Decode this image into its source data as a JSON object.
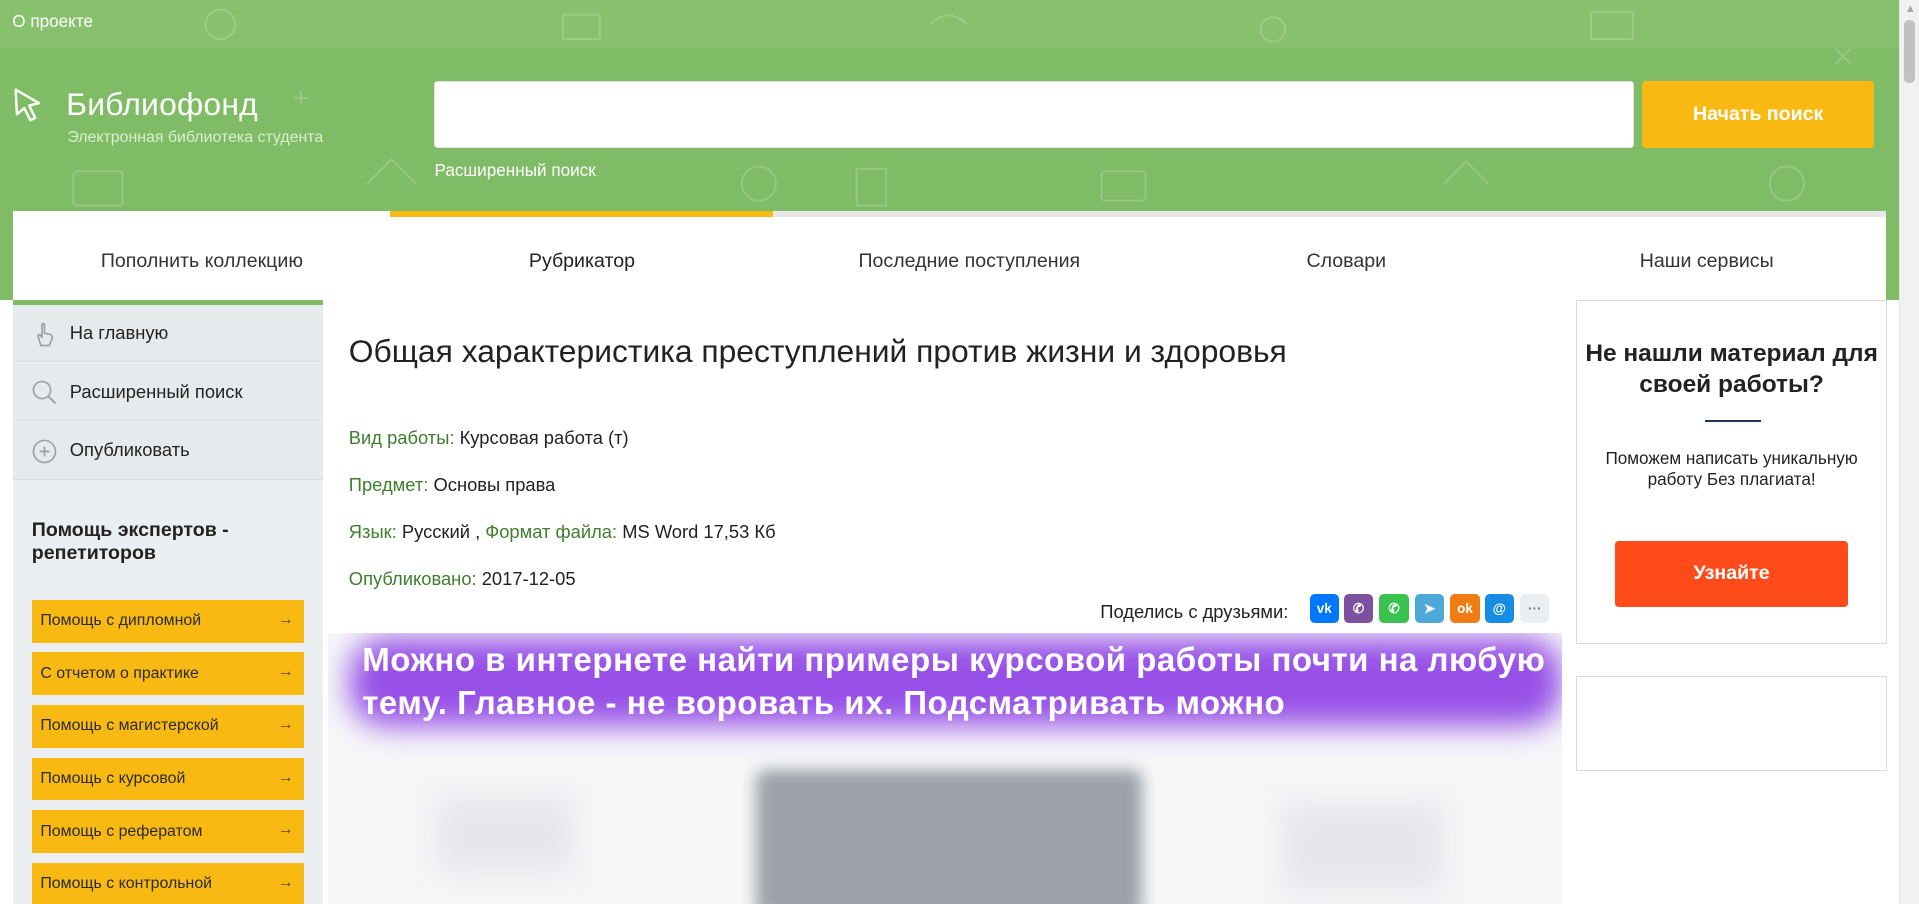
{
  "top": {
    "about_link": "О проекте"
  },
  "logo": {
    "title": "Библиофонд",
    "subtitle": "Электронная библиотека студента"
  },
  "search": {
    "value": "",
    "placeholder": "",
    "button": "Начать поиск",
    "advanced_link": "Расширенный поиск"
  },
  "nav": {
    "items": [
      {
        "label": "Пополнить коллекцию"
      },
      {
        "label": "Рубрикатор",
        "active": true
      },
      {
        "label": "Последние поступления"
      },
      {
        "label": "Словари"
      },
      {
        "label": "Наши сервисы"
      }
    ]
  },
  "sidebar": {
    "items": [
      {
        "label": "На главную",
        "icon": "hand-pointer-icon"
      },
      {
        "label": "Расширенный поиск",
        "icon": "magnifier-icon"
      },
      {
        "label": "Опубликовать",
        "icon": "plus-circle-icon"
      }
    ],
    "help_heading": "Помощь экспертов - репетиторов",
    "help_buttons": [
      "Помощь с дипломной",
      "С отчетом о практике",
      "Помощь с магистерской",
      "Помощь с курсовой",
      "Помощь с рефератом",
      "Помощь с контрольной"
    ],
    "arrow": "→"
  },
  "article": {
    "title": "Общая характеристика преступлений против жизни и здоровья",
    "work_type_label": "Вид работы:",
    "work_type": "Курсовая работа (т)",
    "subject_label": "Предмет:",
    "subject": "Основы права",
    "language_label": "Язык:",
    "language": "Русский",
    "comma": ",",
    "format_label": "Формат файла:",
    "format": "MS Word 17,53 Кб",
    "published_label": "Опубликовано:",
    "published": "2017-12-05"
  },
  "share": {
    "label": "Поделись с друзьями:",
    "icons": [
      {
        "name": "vk-icon",
        "glyph": "vk",
        "color": "#0077ff"
      },
      {
        "name": "viber-icon",
        "glyph": "✆",
        "color": "#7d51a0"
      },
      {
        "name": "whatsapp-icon",
        "glyph": "✆",
        "color": "#3ac24f"
      },
      {
        "name": "telegram-icon",
        "glyph": "➤",
        "color": "#4ea9d9"
      },
      {
        "name": "odnoklassniki-icon",
        "glyph": "ok",
        "color": "#ef7d14"
      },
      {
        "name": "moimir-icon",
        "glyph": "@",
        "color": "#168de2"
      },
      {
        "name": "more-icon",
        "glyph": "···",
        "color": "#eceff1"
      }
    ]
  },
  "banner": {
    "text": "Можно в интернете найти примеры курсовой работы почти на любую тему. Главное - не воровать их. Подсматривать можно"
  },
  "promo": {
    "title": "Не нашли материал для своей работы?",
    "text": "Поможем написать уникальную работу Без плагиата!",
    "button": "Узнайте"
  },
  "colors": {
    "header_green": "#80bc66",
    "accent_yellow": "#f8b912",
    "promo_orange": "#ff4a1a",
    "label_green": "#3e7f2c"
  }
}
